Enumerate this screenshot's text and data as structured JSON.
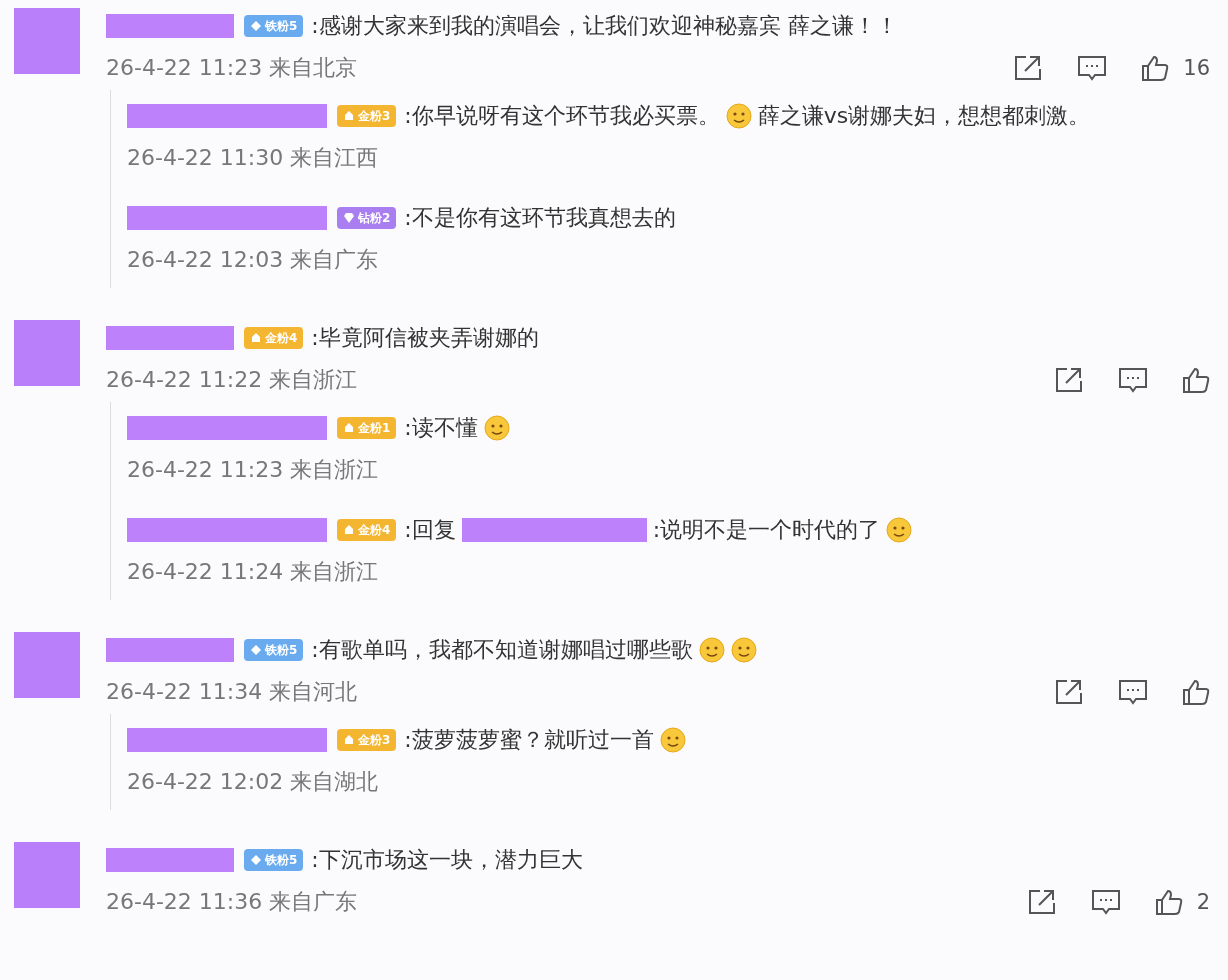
{
  "threads": [
    {
      "comment": {
        "badge": {
          "label": "铁粉5",
          "kind": "iron"
        },
        "segments": [
          {
            "kind": "text",
            "text": ":感谢大家来到我的演唱会，让我们欢迎神秘嘉宾  薛之谦！！"
          }
        ],
        "time": "26-4-22 11:23 来自北京",
        "like_count": "16"
      },
      "replies": [
        {
          "badge": {
            "label": "金粉3",
            "kind": "gold"
          },
          "segments": [
            {
              "kind": "text",
              "text": ":你早说呀有这个环节我必买票。"
            },
            {
              "kind": "emoji"
            },
            {
              "kind": "text",
              "text": "薛之谦vs谢娜夫妇，想想都刺激。"
            }
          ],
          "time": "26-4-22 11:30 来自江西"
        },
        {
          "badge": {
            "label": "钻粉2",
            "kind": "diamond"
          },
          "segments": [
            {
              "kind": "text",
              "text": ":不是你有这环节我真想去的"
            }
          ],
          "time": "26-4-22 12:03 来自广东"
        }
      ]
    },
    {
      "comment": {
        "badge": {
          "label": "金粉4",
          "kind": "gold"
        },
        "segments": [
          {
            "kind": "text",
            "text": ":毕竟阿信被夹弄谢娜的"
          }
        ],
        "time": "26-4-22 11:22 来自浙江"
      },
      "replies": [
        {
          "badge": {
            "label": "金粉1",
            "kind": "gold"
          },
          "segments": [
            {
              "kind": "text",
              "text": ":读不懂"
            },
            {
              "kind": "emoji"
            }
          ],
          "time": "26-4-22 11:23 来自浙江"
        },
        {
          "badge": {
            "label": "金粉4",
            "kind": "gold"
          },
          "segments": [
            {
              "kind": "text",
              "text": ":回复"
            },
            {
              "kind": "redaction"
            },
            {
              "kind": "text",
              "text": ":说明不是一个时代的了"
            },
            {
              "kind": "emoji"
            }
          ],
          "time": "26-4-22 11:24 来自浙江"
        }
      ]
    },
    {
      "comment": {
        "badge": {
          "label": "铁粉5",
          "kind": "iron"
        },
        "segments": [
          {
            "kind": "text",
            "text": ":有歌单吗，我都不知道谢娜唱过哪些歌"
          },
          {
            "kind": "emoji"
          },
          {
            "kind": "emoji"
          }
        ],
        "time": "26-4-22 11:34 来自河北"
      },
      "replies": [
        {
          "badge": {
            "label": "金粉3",
            "kind": "gold"
          },
          "segments": [
            {
              "kind": "text",
              "text": ":菠萝菠萝蜜？就听过一首"
            },
            {
              "kind": "emoji"
            }
          ],
          "time": "26-4-22 12:02 来自湖北"
        }
      ]
    },
    {
      "comment": {
        "badge": {
          "label": "铁粉5",
          "kind": "iron"
        },
        "segments": [
          {
            "kind": "text",
            "text": ":下沉市场这一块，潜力巨大"
          }
        ],
        "time": "26-4-22 11:36 来自广东",
        "like_count": "2"
      }
    }
  ]
}
